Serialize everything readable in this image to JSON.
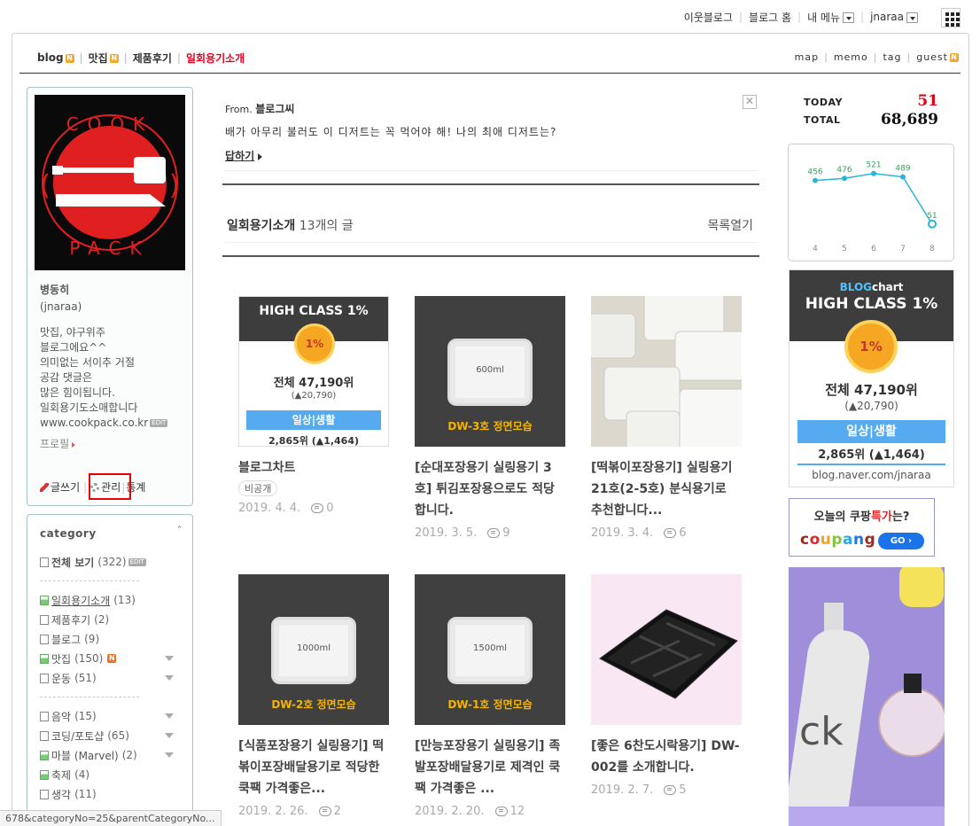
{
  "top_nav": {
    "items": [
      "이웃블로그",
      "블로그 홈",
      "내 메뉴",
      "jnaraa"
    ]
  },
  "menu": {
    "items": [
      "blog",
      "맛집",
      "제품후기",
      "일회용기소개"
    ],
    "right": [
      "map",
      "memo",
      "tag",
      "guest"
    ],
    "new_badge": "N"
  },
  "profile": {
    "logo_top": "COOK",
    "logo_bottom": "PACK",
    "name": "병동히",
    "id": "(jnaraa)",
    "desc": [
      "맛집, 야구위주",
      "블로그에요^^",
      "의미없는 서이추 거절",
      "공감 댓글은",
      "많은 힘이됩니다.",
      "일회용기도소매합니다",
      "www.cookpack.co.kr"
    ],
    "edit_badge": "EDIT",
    "profile_link": "프로필",
    "write": "글쓰기",
    "manage": "관리",
    "stats": "통계"
  },
  "category": {
    "title": "category",
    "toggle": "˄",
    "all_label": "전체 보기",
    "all_count": "(322)",
    "edit_badge": "EDIT",
    "group1": [
      {
        "label": "일회용기소개",
        "count": "(13)",
        "icon": "image-doc"
      },
      {
        "label": "제품후기",
        "count": "(2)",
        "icon": "doc"
      },
      {
        "label": "블로그",
        "count": "(9)",
        "icon": "doc"
      },
      {
        "label": "맛집",
        "count": "(150)",
        "icon": "image-doc"
      },
      {
        "label": "운동",
        "count": "(51)",
        "icon": "doc"
      }
    ],
    "group2": [
      {
        "label": "음악",
        "count": "(15)",
        "icon": "doc"
      },
      {
        "label": "코딩/포토샵",
        "count": "(65)",
        "icon": "doc"
      },
      {
        "label": "마블 (Marvel)",
        "count": "(2)",
        "icon": "image-doc"
      },
      {
        "label": "축제",
        "count": "(4)",
        "icon": "image-doc"
      },
      {
        "label": "생각",
        "count": "(11)",
        "icon": "doc"
      }
    ]
  },
  "reply": {
    "from_prefix": "From.",
    "from_name": "블로그씨",
    "text": "배가 아무리 불러도 이 디저트는 꼭 먹어야 해! 나의 최애 디저트는?",
    "link": "답하기",
    "close": "✕"
  },
  "list": {
    "category": "일회용기소개",
    "count": "13개의 글",
    "open": "목록열기"
  },
  "posts": [
    {
      "title": "블로그차트",
      "tag": "비공개",
      "date": "2019. 4. 4.",
      "comments": "0"
    },
    {
      "title": "[순대포장용기 실링용기 3호] 튀김포장용으로도 적당합니다.",
      "date": "2019. 3. 5.",
      "comments": "9"
    },
    {
      "title": "[떡볶이포장용기] 실링용기 21호(2-5호) 분식용기로 추천합니다...",
      "date": "2019. 3. 4.",
      "comments": "6"
    },
    {
      "title": "[식품포장용기 실링용기] 떡볶이포장배달용기로 적당한 쿡팩 가격좋은...",
      "date": "2019. 2. 26.",
      "comments": "2"
    },
    {
      "title": "[만능포장용기 실링용기] 족발포장배달용기로 제격인 쿡팩 가격좋은 ...",
      "date": "2019. 2. 20.",
      "comments": "12"
    },
    {
      "title": "[좋은 6찬도시락용기] DW-002를 소개합니다.",
      "date": "2019. 2. 7.",
      "comments": "5"
    }
  ],
  "thumbs": {
    "hc_title": "HIGH CLASS 1%",
    "hc_medal": "1%",
    "hc_rank": "전체 47,190위",
    "hc_delta": "(▲20,790)",
    "hc_cat": "일상|생활",
    "hc_sub": "2,865위 (▲1,464)",
    "pkg": [
      {
        "vol": "600ml",
        "cap": "DW-3호 정면모습"
      },
      {
        "vol": "1000ml",
        "cap": "DW-2호 정면모습"
      },
      {
        "vol": "1500ml",
        "cap": "DW-1호 정면모습"
      }
    ]
  },
  "visitors": {
    "today_label": "TODAY",
    "today": "51",
    "total_label": "TOTAL",
    "total": "68,689"
  },
  "chart_data": {
    "type": "line",
    "categories": [
      "4",
      "5",
      "6",
      "7",
      "8"
    ],
    "values": [
      456,
      476,
      521,
      489,
      51
    ],
    "ylim": [
      0,
      560
    ],
    "grid": false
  },
  "blogchart": {
    "brand_a": "BLOG",
    "brand_b": "chart",
    "title": "HIGH CLASS 1%",
    "medal": "1%",
    "rank": "전체 47,190위",
    "delta": "(▲20,790)",
    "cat": "일상|생활",
    "sub": "2,865위 (▲1,464)",
    "url": "blog.naver.com/jnaraa"
  },
  "coupang": {
    "q_a": "오늘의 쿠팡",
    "q_b": "특가",
    "q_c": "는?",
    "logo": "coupang",
    "go": "GO ›"
  },
  "ad": {
    "text": "ck"
  },
  "colors": {
    "accent_red": "#e60012",
    "chart_line": "#29b6d8",
    "chart_label": "#3aa05a"
  },
  "status_url": "678&categoryNo=25&parentCategoryNo..."
}
